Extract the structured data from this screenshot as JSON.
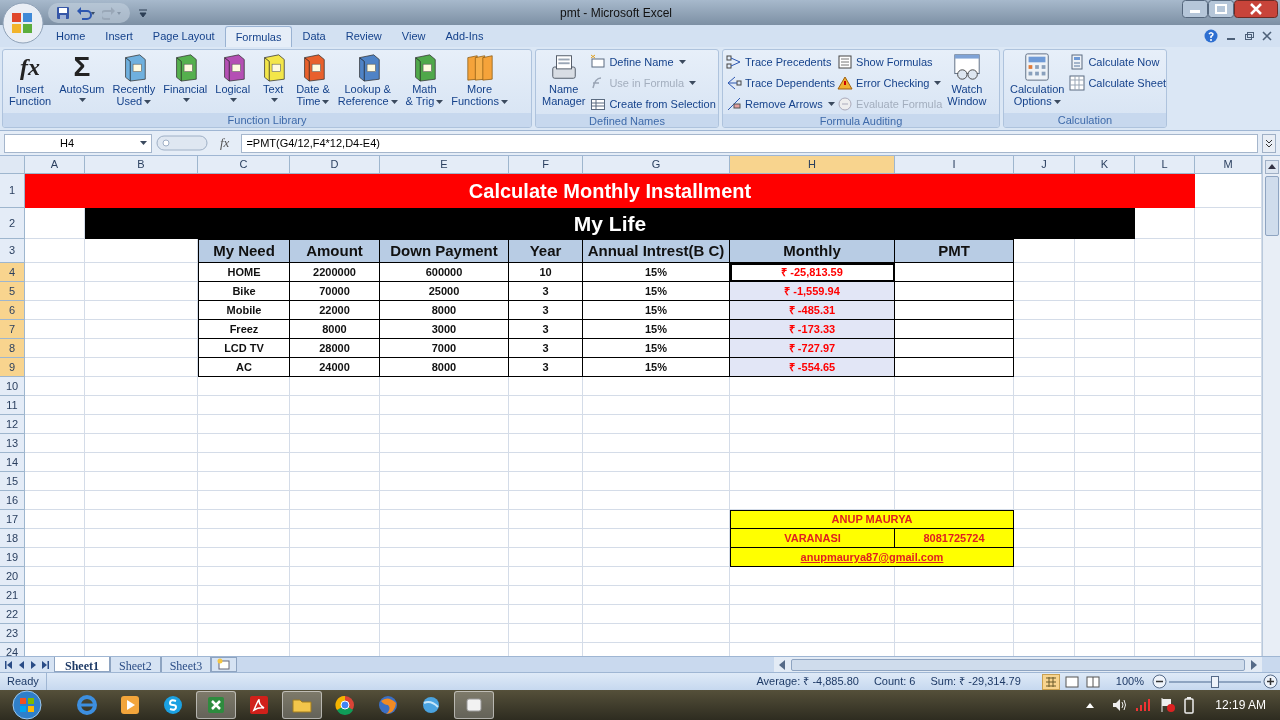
{
  "window": {
    "title": "pmt - Microsoft Excel"
  },
  "ribbon": {
    "tabs": [
      {
        "label": "Home",
        "selected": false
      },
      {
        "label": "Insert",
        "selected": false
      },
      {
        "label": "Page Layout",
        "selected": false
      },
      {
        "label": "Formulas",
        "selected": true
      },
      {
        "label": "Data",
        "selected": false
      },
      {
        "label": "Review",
        "selected": false
      },
      {
        "label": "View",
        "selected": false
      },
      {
        "label": "Add-Ins",
        "selected": false
      }
    ],
    "groups": [
      {
        "label": "Function Library",
        "items": [
          {
            "label": "Insert\nFunction",
            "kind": "large",
            "glyph": "fx",
            "dropdown": false,
            "disabled": false
          },
          {
            "label": "AutoSum",
            "kind": "large",
            "glyph": "Σ",
            "dropdown": true,
            "disabled": false
          },
          {
            "label": "Recently\nUsed",
            "kind": "large",
            "dropdown": true,
            "disabled": false
          },
          {
            "label": "Financial",
            "kind": "large",
            "dropdown": true,
            "disabled": false
          },
          {
            "label": "Logical",
            "kind": "large",
            "dropdown": true,
            "disabled": false
          },
          {
            "label": "Text",
            "kind": "large",
            "dropdown": true,
            "disabled": false
          },
          {
            "label": "Date &\nTime",
            "kind": "large",
            "dropdown": true,
            "disabled": false
          },
          {
            "label": "Lookup &\nReference",
            "kind": "large",
            "dropdown": true,
            "disabled": false
          },
          {
            "label": "Math\n& Trig",
            "kind": "large",
            "dropdown": true,
            "disabled": false
          },
          {
            "label": "More\nFunctions",
            "kind": "large",
            "dropdown": true,
            "disabled": false
          }
        ]
      },
      {
        "label": "Defined Names",
        "items": [
          {
            "label": "Name\nManager",
            "kind": "large",
            "dropdown": false,
            "disabled": false
          },
          {
            "label": "Define Name",
            "kind": "small",
            "dropdown": true,
            "disabled": false
          },
          {
            "label": "Use in Formula",
            "kind": "small",
            "dropdown": true,
            "disabled": true
          },
          {
            "label": "Create from Selection",
            "kind": "small",
            "dropdown": false,
            "disabled": false
          }
        ]
      },
      {
        "label": "Formula Auditing",
        "items": [
          {
            "label": "Trace Precedents",
            "kind": "small",
            "dropdown": false,
            "disabled": false
          },
          {
            "label": "Trace Dependents",
            "kind": "small",
            "dropdown": false,
            "disabled": false
          },
          {
            "label": "Remove Arrows",
            "kind": "small",
            "dropdown": true,
            "disabled": false
          },
          {
            "label": "Show Formulas",
            "kind": "small",
            "dropdown": false,
            "disabled": false
          },
          {
            "label": "Error Checking",
            "kind": "small",
            "dropdown": true,
            "disabled": false
          },
          {
            "label": "Evaluate Formula",
            "kind": "small",
            "dropdown": false,
            "disabled": true
          },
          {
            "label": "Watch\nWindow",
            "kind": "large",
            "dropdown": false,
            "disabled": false
          }
        ]
      },
      {
        "label": "Calculation",
        "items": [
          {
            "label": "Calculation\nOptions",
            "kind": "large",
            "dropdown": true,
            "disabled": false
          },
          {
            "label": "Calculate Now",
            "kind": "small",
            "dropdown": false,
            "disabled": false
          },
          {
            "label": "Calculate Sheet",
            "kind": "small",
            "dropdown": false,
            "disabled": false
          }
        ]
      }
    ]
  },
  "formula_bar": {
    "name_box": "H4",
    "fx": "fx",
    "formula": "=PMT(G4/12,F4*12,D4-E4)"
  },
  "sheet": {
    "columns": [
      {
        "label": "A",
        "selected": false
      },
      {
        "label": "B",
        "selected": false
      },
      {
        "label": "C",
        "selected": false
      },
      {
        "label": "D",
        "selected": false
      },
      {
        "label": "E",
        "selected": false
      },
      {
        "label": "F",
        "selected": false
      },
      {
        "label": "G",
        "selected": false
      },
      {
        "label": "H",
        "selected": true
      },
      {
        "label": "I",
        "selected": false
      },
      {
        "label": "J",
        "selected": false
      },
      {
        "label": "K",
        "selected": false
      },
      {
        "label": "L",
        "selected": false
      },
      {
        "label": "M",
        "selected": false
      }
    ],
    "rows": [
      {
        "label": "1",
        "selected": false
      },
      {
        "label": "2",
        "selected": false
      },
      {
        "label": "3",
        "selected": false
      },
      {
        "label": "4",
        "selected": true
      },
      {
        "label": "5",
        "selected": true
      },
      {
        "label": "6",
        "selected": true
      },
      {
        "label": "7",
        "selected": true
      },
      {
        "label": "8",
        "selected": true
      },
      {
        "label": "9",
        "selected": true
      },
      {
        "label": "10",
        "selected": false
      },
      {
        "label": "11",
        "selected": false
      },
      {
        "label": "12",
        "selected": false
      },
      {
        "label": "13",
        "selected": false
      },
      {
        "label": "14",
        "selected": false
      },
      {
        "label": "15",
        "selected": false
      },
      {
        "label": "16",
        "selected": false
      },
      {
        "label": "17",
        "selected": false
      },
      {
        "label": "18",
        "selected": false
      },
      {
        "label": "19",
        "selected": false
      },
      {
        "label": "20",
        "selected": false
      },
      {
        "label": "21",
        "selected": false
      },
      {
        "label": "22",
        "selected": false
      },
      {
        "label": "23",
        "selected": false
      },
      {
        "label": "24",
        "selected": false
      }
    ],
    "title": "Calculate Monthly Installment",
    "subtitle": "My Life",
    "table": {
      "columns": [
        "My Need",
        "Amount",
        "Down Payment",
        "Year",
        "Annual Intrest(B C)",
        "Monthly",
        "PMT"
      ],
      "rows": [
        {
          "cells": [
            "HOME",
            "2200000",
            "600000",
            "10",
            "15%",
            "₹ -25,813.59"
          ],
          "selected": true,
          "active": true
        },
        {
          "cells": [
            "Bike",
            "70000",
            "25000",
            "3",
            "15%",
            "₹ -1,559.94"
          ],
          "selected": true,
          "active": false
        },
        {
          "cells": [
            "Mobile",
            "22000",
            "8000",
            "3",
            "15%",
            "₹ -485.31"
          ],
          "selected": true,
          "active": false
        },
        {
          "cells": [
            "Freez",
            "8000",
            "3000",
            "3",
            "15%",
            "₹ -173.33"
          ],
          "selected": true,
          "active": false
        },
        {
          "cells": [
            "LCD TV",
            "28000",
            "7000",
            "3",
            "15%",
            "₹ -727.97"
          ],
          "selected": true,
          "active": false
        },
        {
          "cells": [
            "AC",
            "24000",
            "8000",
            "3",
            "15%",
            "₹ -554.65"
          ],
          "selected": true,
          "active": false
        }
      ]
    },
    "contact": {
      "name": "ANUP MAURYA",
      "city": "VARANASI",
      "phone": "8081725724",
      "email": "anupmaurya87@gmail.com"
    }
  },
  "sheet_tabs": [
    {
      "label": "Sheet1",
      "selected": true
    },
    {
      "label": "Sheet2",
      "selected": false
    },
    {
      "label": "Sheet3",
      "selected": false
    }
  ],
  "status_bar": {
    "status": "Ready",
    "stats": [
      "Average: ₹ -4,885.80",
      "Count: 6",
      "Sum: ₹ -29,314.79"
    ],
    "zoom": "100%",
    "zoom_slider": {
      "level": 0.5
    }
  },
  "taskbar": {
    "apps": [
      {
        "active": false
      },
      {
        "active": false
      },
      {
        "active": false
      },
      {
        "active": true
      },
      {
        "active": false
      },
      {
        "active": true
      },
      {
        "active": false
      },
      {
        "active": false
      },
      {
        "active": false
      },
      {
        "active": true
      }
    ],
    "clock": "12:19 AM"
  }
}
